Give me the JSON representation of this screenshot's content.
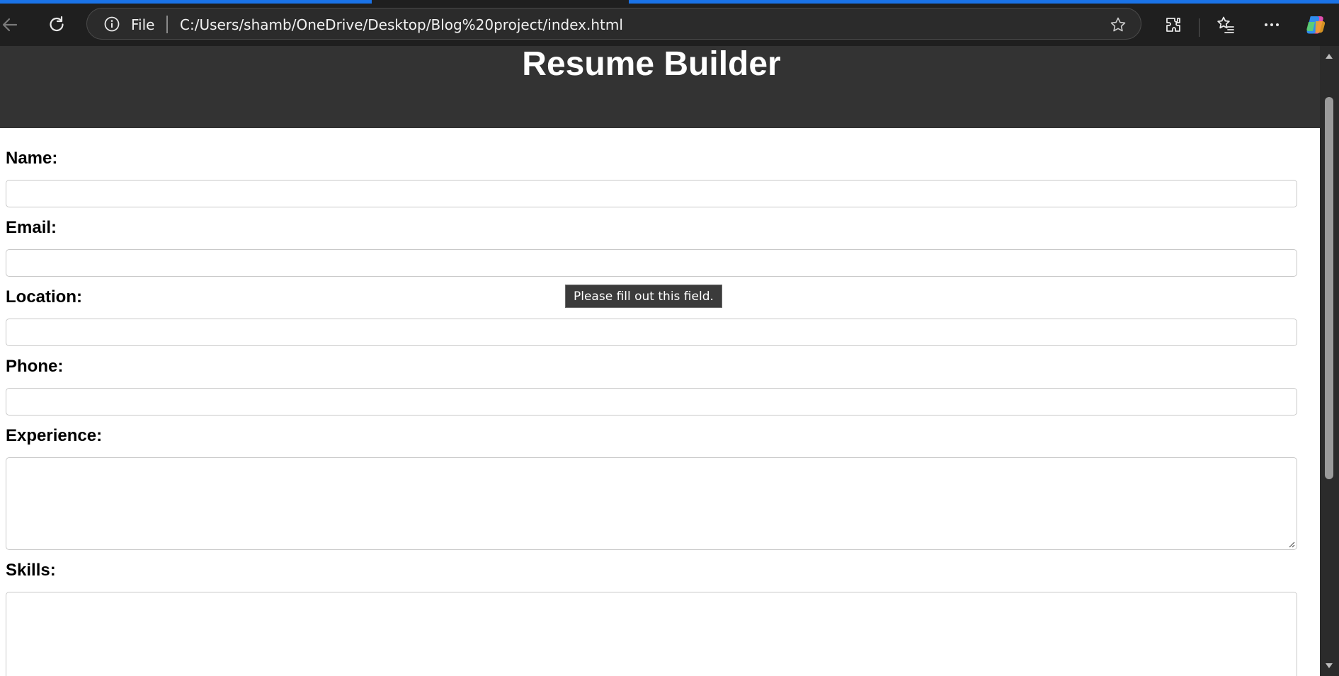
{
  "browser": {
    "scheme_label": "File",
    "url": "C:/Users/shamb/OneDrive/Desktop/Blog%20project/index.html",
    "icons": [
      "back-icon",
      "refresh-icon",
      "info-icon",
      "star-icon",
      "extensions-icon",
      "favorites-icon",
      "more-icon",
      "copilot-icon"
    ]
  },
  "page": {
    "title": "Resume Builder",
    "fields": [
      {
        "label": "Name:",
        "value": ""
      },
      {
        "label": "Email:",
        "value": ""
      },
      {
        "label": "Location:",
        "value": ""
      },
      {
        "label": "Phone:",
        "value": ""
      },
      {
        "label": "Experience:",
        "value": ""
      },
      {
        "label": "Skills:",
        "value": ""
      }
    ],
    "validation_tooltip": "Please fill out this field."
  },
  "colors": {
    "header_bg": "#333333",
    "browser_bg": "#1f1f1f",
    "accent": "#1a73e8"
  }
}
